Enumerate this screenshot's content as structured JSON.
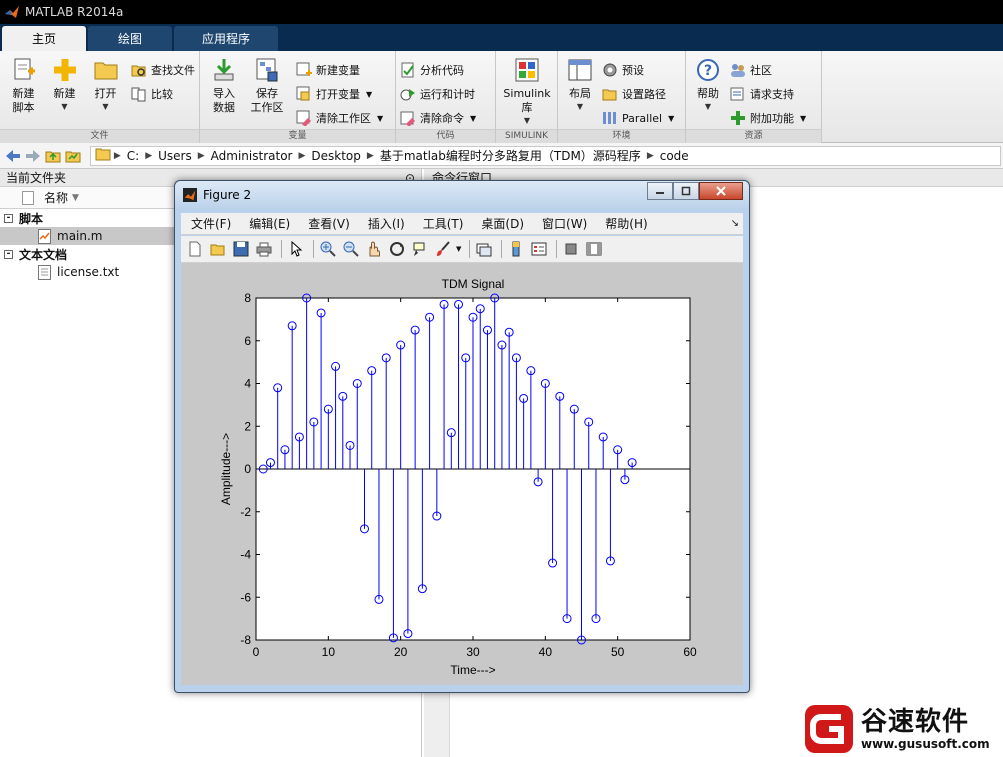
{
  "window": {
    "title": "MATLAB R2014a"
  },
  "tabs": [
    {
      "label": "主页",
      "active": true
    },
    {
      "label": "绘图",
      "active": false
    },
    {
      "label": "应用程序",
      "active": false
    }
  ],
  "ribbon": {
    "file": {
      "caption": "文件",
      "new_script": "新建\n脚本",
      "new": "新建",
      "open": "打开",
      "find_files": "查找文件",
      "compare": "比较"
    },
    "variable": {
      "caption": "变量",
      "import_data": "导入\n数据",
      "save_workspace": "保存\n工作区",
      "new_variable": "新建变量",
      "open_variable": "打开变量",
      "clear_workspace": "清除工作区"
    },
    "code": {
      "caption": "代码",
      "analyze_code": "分析代码",
      "run_and_time": "运行和计时",
      "clear_commands": "清除命令"
    },
    "simulink": {
      "caption": "SIMULINK",
      "library": "Simulink\n库"
    },
    "environment": {
      "caption": "环境",
      "layout": "布局",
      "preferences": "预设",
      "set_path": "设置路径",
      "parallel": "Parallel"
    },
    "resources": {
      "caption": "资源",
      "help": "帮助",
      "community": "社区",
      "request_support": "请求支持",
      "addons": "附加功能"
    }
  },
  "address": {
    "crumbs": [
      "C:",
      "Users",
      "Administrator",
      "Desktop",
      "基于matlab编程时分多路复用（TDM）源码程序",
      "code"
    ]
  },
  "current_folder": {
    "title": "当前文件夹",
    "column_name": "名称",
    "groups": [
      {
        "label": "脚本",
        "items": [
          {
            "name": "main.m",
            "selected": true
          }
        ]
      },
      {
        "label": "文本文档",
        "items": [
          {
            "name": "license.txt",
            "selected": false
          }
        ]
      }
    ]
  },
  "command_window": {
    "title": "命令行窗口"
  },
  "figure": {
    "title": "Figure 2",
    "menus": [
      "文件(F)",
      "编辑(E)",
      "查看(V)",
      "插入(I)",
      "工具(T)",
      "桌面(D)",
      "窗口(W)",
      "帮助(H)"
    ],
    "toolbar_icons": [
      "new-figure-icon",
      "open-file-icon",
      "save-icon",
      "print-icon",
      "pointer-icon",
      "zoom-in-icon",
      "zoom-out-icon",
      "pan-icon",
      "rotate-icon",
      "data-cursor-icon",
      "brush-icon",
      "link-plot-icon",
      "colorbar-icon",
      "legend-icon",
      "hide-plot-tools-icon",
      "show-plot-tools-icon"
    ]
  },
  "chart_data": {
    "type": "stem",
    "title": "TDM Signal",
    "xlabel": "Time--->",
    "ylabel": "Amplitude--->",
    "xlim": [
      0,
      60
    ],
    "ylim": [
      -8,
      8
    ],
    "xticks": [
      0,
      10,
      20,
      30,
      40,
      50,
      60
    ],
    "yticks": [
      -8,
      -6,
      -4,
      -2,
      0,
      2,
      4,
      6,
      8
    ],
    "series_color": "#0000ff",
    "x": [
      1,
      2,
      3,
      4,
      5,
      6,
      7,
      8,
      9,
      10,
      11,
      12,
      13,
      14,
      15,
      16,
      17,
      18,
      19,
      20,
      21,
      22,
      23,
      24,
      25,
      26,
      27,
      28,
      29,
      30,
      31,
      32,
      33,
      34,
      35,
      36,
      37,
      38,
      39,
      40,
      41,
      42,
      43,
      44,
      45,
      46,
      47,
      48,
      49,
      50,
      51,
      52
    ],
    "y": [
      0.0,
      0.3,
      3.8,
      0.9,
      6.7,
      1.5,
      8.0,
      2.2,
      7.3,
      2.8,
      4.8,
      3.4,
      1.1,
      4.0,
      -2.8,
      4.6,
      -6.1,
      5.2,
      -7.9,
      5.8,
      -7.7,
      6.5,
      -5.6,
      7.1,
      -2.2,
      7.7,
      1.7,
      7.7,
      5.2,
      7.1,
      7.5,
      6.5,
      8.0,
      5.8,
      6.4,
      5.2,
      3.3,
      4.6,
      -0.6,
      4.0,
      -4.4,
      3.4,
      -7.0,
      2.8,
      -8.0,
      2.2,
      -7.0,
      1.5,
      -4.3,
      0.9,
      -0.5,
      0.3
    ]
  },
  "watermark": {
    "brand": "谷速软件",
    "url": "www.gususoft.com"
  }
}
